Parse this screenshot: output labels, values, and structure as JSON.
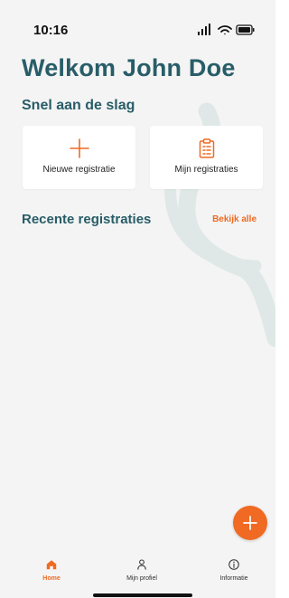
{
  "status_bar": {
    "time": "10:16"
  },
  "header": {
    "title": "Welkom John Doe",
    "subtitle": "Snel aan de slag"
  },
  "quick_actions": [
    {
      "label": "Nieuwe registratie",
      "icon": "plus-icon"
    },
    {
      "label": "Mijn registraties",
      "icon": "clipboard-icon"
    }
  ],
  "recent_section": {
    "title": "Recente registraties",
    "see_all_label": "Bekijk alle"
  },
  "fab": {
    "icon": "plus-icon"
  },
  "tab_bar": {
    "items": [
      {
        "label": "Home",
        "icon": "home-icon",
        "active": true
      },
      {
        "label": "Mijn profiel",
        "icon": "user-icon",
        "active": false
      },
      {
        "label": "Informatie",
        "icon": "info-icon",
        "active": false
      }
    ]
  },
  "colors": {
    "background": "#f4f4f4",
    "primary_text": "#285d68",
    "accent": "#ef6a22",
    "card": "#ffffff",
    "decor": "#dfe8e6"
  }
}
